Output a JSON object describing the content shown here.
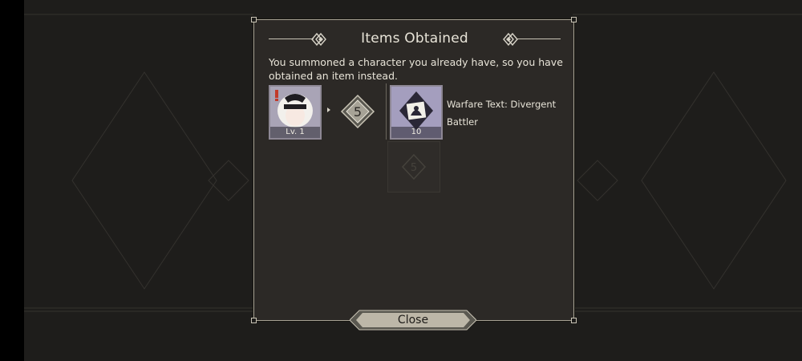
{
  "dialog": {
    "title": "Items Obtained",
    "message": "You summoned a character you already have, so you have obtained an item instead.",
    "close_label": "Close"
  },
  "character": {
    "level_label": "Lv. 1",
    "icon": "character-portrait-icon"
  },
  "rarity_badge": {
    "value": "5"
  },
  "ghost_badge": {
    "value": "5"
  },
  "reward_item": {
    "name": "Warfare Text: Divergent Battler",
    "quantity": "10",
    "icon": "warfare-text-icon"
  },
  "colors": {
    "background": "#1e1d1b",
    "panel": "#2c2926",
    "panel_border": "#a7a294",
    "text": "#e8e4d8",
    "button": "#bdb7a8"
  }
}
